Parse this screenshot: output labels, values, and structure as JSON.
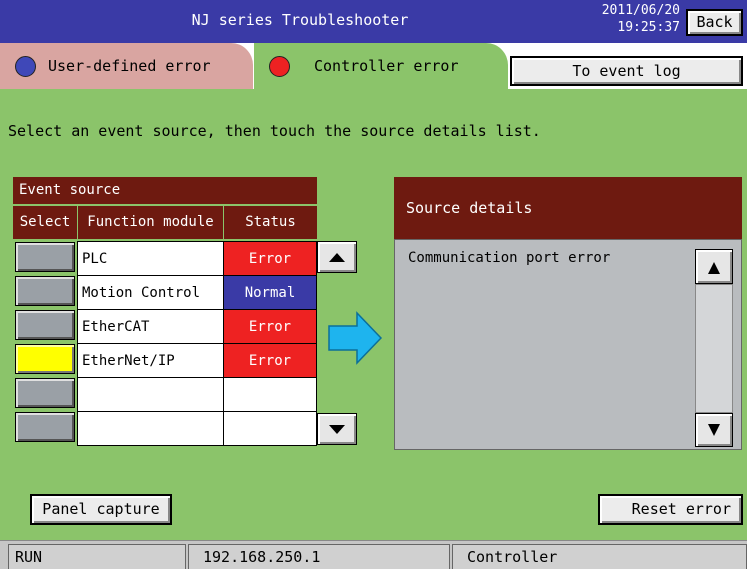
{
  "header": {
    "title": "NJ series Troubleshooter",
    "date": "2011/06/20",
    "time": "19:25:37",
    "back_label": "Back"
  },
  "tabs": [
    {
      "label": "User-defined error",
      "dot_color": "#3f48b8",
      "bg": "#d9a5a1"
    },
    {
      "label": "Controller error",
      "dot_color": "#ee2222",
      "bg": "#8bc46a",
      "active": true
    }
  ],
  "to_event_log_label": "To event log",
  "instruction": "Select an event source, then touch the source details list.",
  "event_source": {
    "title": "Event source",
    "columns": [
      "Select",
      "Function module",
      "Status"
    ],
    "rows": [
      {
        "module": "PLC",
        "status": "Error",
        "selected": false
      },
      {
        "module": "Motion Control",
        "status": "Normal",
        "selected": false
      },
      {
        "module": "EtherCAT",
        "status": "Error",
        "selected": false
      },
      {
        "module": "EtherNet/IP",
        "status": "Error",
        "selected": true
      },
      {
        "module": "",
        "status": "",
        "selected": false
      },
      {
        "module": "",
        "status": "",
        "selected": false
      }
    ]
  },
  "status_colors": {
    "Error": "#ee2222",
    "Normal": "#3a3aa6"
  },
  "source_details": {
    "title": "Source details",
    "items": [
      "Communication port error"
    ]
  },
  "buttons": {
    "panel_capture": "Panel capture",
    "reset_error": "Reset error"
  },
  "statusbar": {
    "mode": "RUN",
    "ip": "192.168.250.1",
    "device": "Controller"
  }
}
